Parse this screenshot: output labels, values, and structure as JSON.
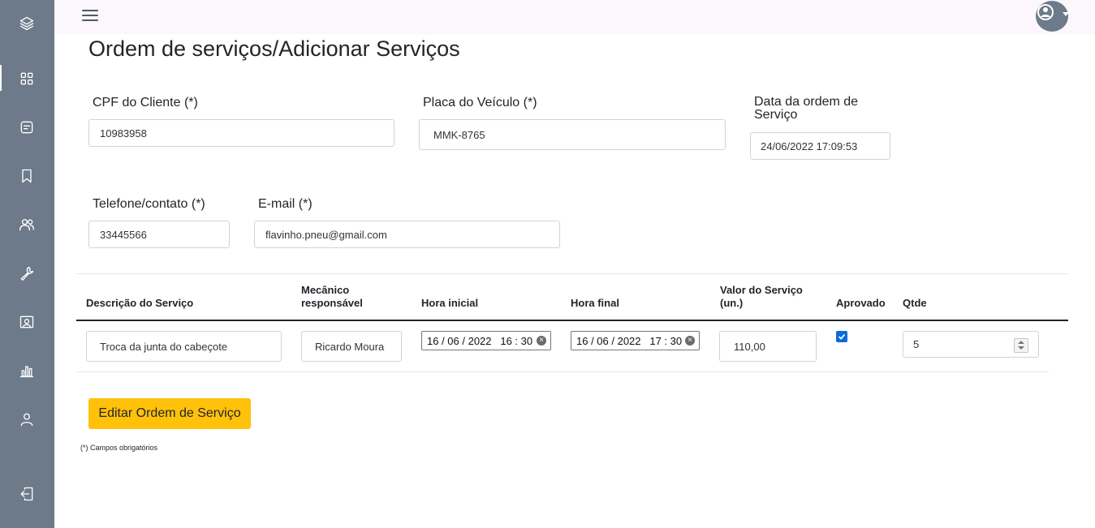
{
  "page": {
    "title": "Ordem de serviços/Adicionar Serviços"
  },
  "sidebar": {
    "items": [
      {
        "icon": "layers-icon"
      },
      {
        "icon": "dashboard-grid-icon"
      },
      {
        "icon": "note-icon"
      },
      {
        "icon": "bookmark-icon"
      },
      {
        "icon": "users-icon"
      },
      {
        "icon": "wrench-icon"
      },
      {
        "icon": "id-card-icon"
      },
      {
        "icon": "bar-chart-icon"
      },
      {
        "icon": "user-icon"
      },
      {
        "icon": "logout-icon"
      }
    ]
  },
  "form": {
    "cpf_label": "CPF do Cliente (*)",
    "cpf_value": "10983958",
    "placa_label": "Placa do Veículo (*)",
    "placa_value": "MMK-8765",
    "data_label_line1": "Data da ordem de",
    "data_label_line2": "Serviço",
    "data_value": "24/06/2022 17:09:53",
    "telefone_label": "Telefone/contato (*)",
    "telefone_value": "33445566",
    "email_label": "E-mail (*)",
    "email_value": "flavinho.pneu@gmail.com"
  },
  "table": {
    "headers": {
      "descricao": "Descrição do Serviço",
      "mecanico_line1": "Mecânico",
      "mecanico_line2": "responsável",
      "hora_inicial": "Hora inicial",
      "hora_final": "Hora final",
      "valor_line1": "Valor do Serviço",
      "valor_line2": "(un.)",
      "aprovado": "Aprovado",
      "qtde": "Qtde"
    },
    "row": {
      "descricao": "Troca da junta do cabeçote",
      "mecanico": "Ricardo Moura",
      "hora_inicial": "16 / 06 / 2022   16 : 30",
      "hora_final": "16 / 06 / 2022   17 : 30",
      "valor": "110,00",
      "aprovado": true,
      "qtde": "5"
    }
  },
  "actions": {
    "submit_label": "Editar Ordem de Serviço"
  },
  "footer": {
    "note": "(*) Campos obrigatórios"
  },
  "colors": {
    "sidebar": "#6c7a89",
    "topbar": "#fbf7fd",
    "button": "#ffc10a",
    "checkbox": "#0b6bd8"
  }
}
